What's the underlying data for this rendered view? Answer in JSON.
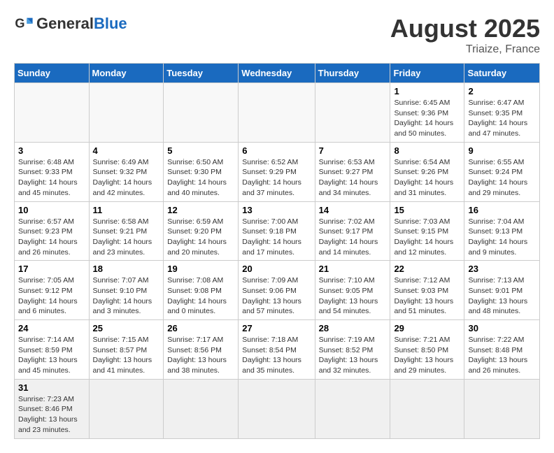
{
  "header": {
    "logo_general": "General",
    "logo_blue": "Blue",
    "title": "August 2025",
    "subtitle": "Triaize, France"
  },
  "days_of_week": [
    "Sunday",
    "Monday",
    "Tuesday",
    "Wednesday",
    "Thursday",
    "Friday",
    "Saturday"
  ],
  "weeks": [
    [
      {
        "day": "",
        "detail": ""
      },
      {
        "day": "",
        "detail": ""
      },
      {
        "day": "",
        "detail": ""
      },
      {
        "day": "",
        "detail": ""
      },
      {
        "day": "",
        "detail": ""
      },
      {
        "day": "1",
        "detail": "Sunrise: 6:45 AM\nSunset: 9:36 PM\nDaylight: 14 hours and 50 minutes."
      },
      {
        "day": "2",
        "detail": "Sunrise: 6:47 AM\nSunset: 9:35 PM\nDaylight: 14 hours and 47 minutes."
      }
    ],
    [
      {
        "day": "3",
        "detail": "Sunrise: 6:48 AM\nSunset: 9:33 PM\nDaylight: 14 hours and 45 minutes."
      },
      {
        "day": "4",
        "detail": "Sunrise: 6:49 AM\nSunset: 9:32 PM\nDaylight: 14 hours and 42 minutes."
      },
      {
        "day": "5",
        "detail": "Sunrise: 6:50 AM\nSunset: 9:30 PM\nDaylight: 14 hours and 40 minutes."
      },
      {
        "day": "6",
        "detail": "Sunrise: 6:52 AM\nSunset: 9:29 PM\nDaylight: 14 hours and 37 minutes."
      },
      {
        "day": "7",
        "detail": "Sunrise: 6:53 AM\nSunset: 9:27 PM\nDaylight: 14 hours and 34 minutes."
      },
      {
        "day": "8",
        "detail": "Sunrise: 6:54 AM\nSunset: 9:26 PM\nDaylight: 14 hours and 31 minutes."
      },
      {
        "day": "9",
        "detail": "Sunrise: 6:55 AM\nSunset: 9:24 PM\nDaylight: 14 hours and 29 minutes."
      }
    ],
    [
      {
        "day": "10",
        "detail": "Sunrise: 6:57 AM\nSunset: 9:23 PM\nDaylight: 14 hours and 26 minutes."
      },
      {
        "day": "11",
        "detail": "Sunrise: 6:58 AM\nSunset: 9:21 PM\nDaylight: 14 hours and 23 minutes."
      },
      {
        "day": "12",
        "detail": "Sunrise: 6:59 AM\nSunset: 9:20 PM\nDaylight: 14 hours and 20 minutes."
      },
      {
        "day": "13",
        "detail": "Sunrise: 7:00 AM\nSunset: 9:18 PM\nDaylight: 14 hours and 17 minutes."
      },
      {
        "day": "14",
        "detail": "Sunrise: 7:02 AM\nSunset: 9:17 PM\nDaylight: 14 hours and 14 minutes."
      },
      {
        "day": "15",
        "detail": "Sunrise: 7:03 AM\nSunset: 9:15 PM\nDaylight: 14 hours and 12 minutes."
      },
      {
        "day": "16",
        "detail": "Sunrise: 7:04 AM\nSunset: 9:13 PM\nDaylight: 14 hours and 9 minutes."
      }
    ],
    [
      {
        "day": "17",
        "detail": "Sunrise: 7:05 AM\nSunset: 9:12 PM\nDaylight: 14 hours and 6 minutes."
      },
      {
        "day": "18",
        "detail": "Sunrise: 7:07 AM\nSunset: 9:10 PM\nDaylight: 14 hours and 3 minutes."
      },
      {
        "day": "19",
        "detail": "Sunrise: 7:08 AM\nSunset: 9:08 PM\nDaylight: 14 hours and 0 minutes."
      },
      {
        "day": "20",
        "detail": "Sunrise: 7:09 AM\nSunset: 9:06 PM\nDaylight: 13 hours and 57 minutes."
      },
      {
        "day": "21",
        "detail": "Sunrise: 7:10 AM\nSunset: 9:05 PM\nDaylight: 13 hours and 54 minutes."
      },
      {
        "day": "22",
        "detail": "Sunrise: 7:12 AM\nSunset: 9:03 PM\nDaylight: 13 hours and 51 minutes."
      },
      {
        "day": "23",
        "detail": "Sunrise: 7:13 AM\nSunset: 9:01 PM\nDaylight: 13 hours and 48 minutes."
      }
    ],
    [
      {
        "day": "24",
        "detail": "Sunrise: 7:14 AM\nSunset: 8:59 PM\nDaylight: 13 hours and 45 minutes."
      },
      {
        "day": "25",
        "detail": "Sunrise: 7:15 AM\nSunset: 8:57 PM\nDaylight: 13 hours and 41 minutes."
      },
      {
        "day": "26",
        "detail": "Sunrise: 7:17 AM\nSunset: 8:56 PM\nDaylight: 13 hours and 38 minutes."
      },
      {
        "day": "27",
        "detail": "Sunrise: 7:18 AM\nSunset: 8:54 PM\nDaylight: 13 hours and 35 minutes."
      },
      {
        "day": "28",
        "detail": "Sunrise: 7:19 AM\nSunset: 8:52 PM\nDaylight: 13 hours and 32 minutes."
      },
      {
        "day": "29",
        "detail": "Sunrise: 7:21 AM\nSunset: 8:50 PM\nDaylight: 13 hours and 29 minutes."
      },
      {
        "day": "30",
        "detail": "Sunrise: 7:22 AM\nSunset: 8:48 PM\nDaylight: 13 hours and 26 minutes."
      }
    ],
    [
      {
        "day": "31",
        "detail": "Sunrise: 7:23 AM\nSunset: 8:46 PM\nDaylight: 13 hours and 23 minutes."
      },
      {
        "day": "",
        "detail": ""
      },
      {
        "day": "",
        "detail": ""
      },
      {
        "day": "",
        "detail": ""
      },
      {
        "day": "",
        "detail": ""
      },
      {
        "day": "",
        "detail": ""
      },
      {
        "day": "",
        "detail": ""
      }
    ]
  ]
}
